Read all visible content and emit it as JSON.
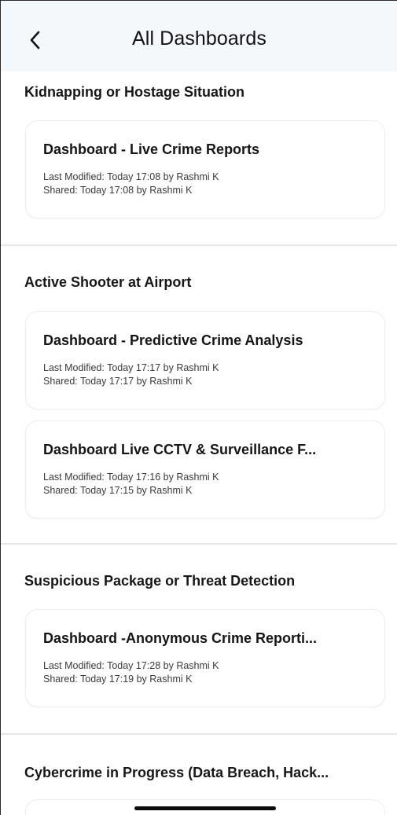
{
  "header": {
    "title": "All Dashboards",
    "back_icon": "chevron-left-icon"
  },
  "sections": [
    {
      "title": "Kidnapping or Hostage Situation",
      "cards": [
        {
          "title": "Dashboard - Live Crime Reports",
          "last_modified": "Last Modified: Today 17:08  by Rashmi K",
          "shared": "Shared: Today 17:08  by Rashmi K"
        }
      ]
    },
    {
      "title": "Active Shooter at Airport",
      "cards": [
        {
          "title": "Dashboard - Predictive Crime Analysis",
          "last_modified": "Last Modified: Today 17:17  by Rashmi K",
          "shared": "Shared: Today 17:17  by Rashmi K"
        },
        {
          "title": "Dashboard Live CCTV & Surveillance F...",
          "last_modified": "Last Modified: Today 17:16  by Rashmi K",
          "shared": "Shared: Today 17:15  by Rashmi K"
        }
      ]
    },
    {
      "title": "Suspicious Package or Threat Detection",
      "cards": [
        {
          "title": "Dashboard -Anonymous Crime Reporti...",
          "last_modified": "Last Modified: Today 17:28  by Rashmi K",
          "shared": "Shared: Today 17:19  by Rashmi K"
        }
      ]
    },
    {
      "title": "Cybercrime in Progress (Data Breach, Hack..."
    }
  ]
}
